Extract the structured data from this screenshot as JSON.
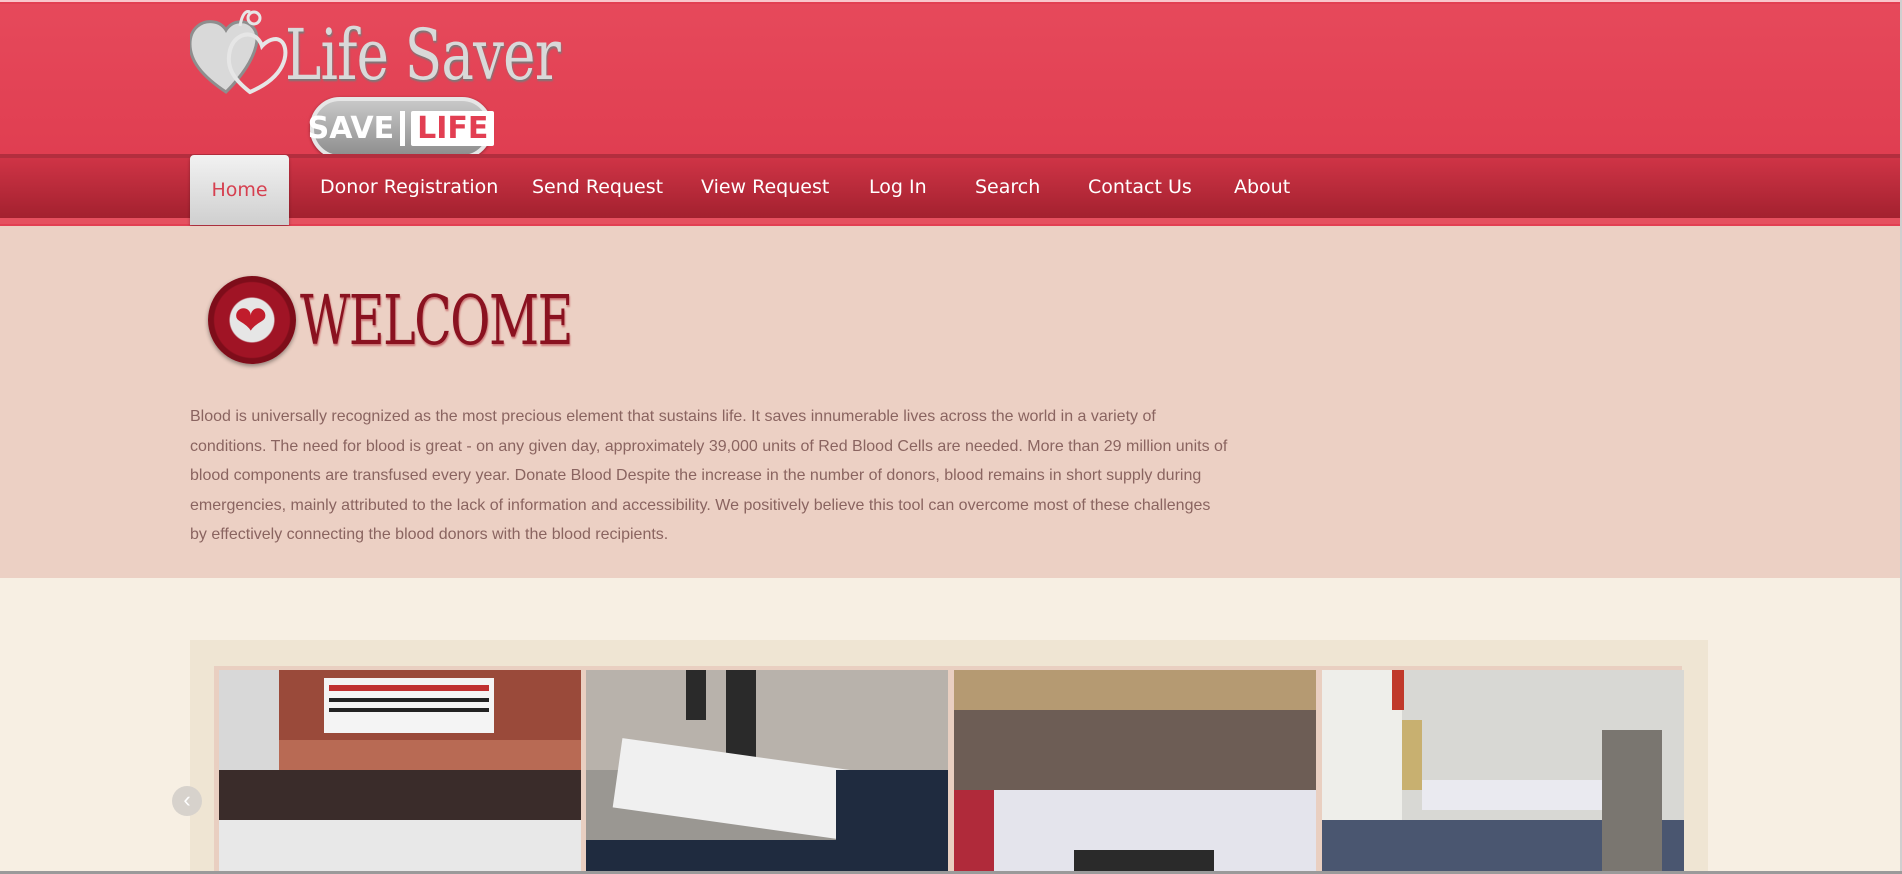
{
  "header": {
    "logo_title": "Life Saver",
    "logo_badge_left": "SAVE",
    "logo_badge_right": "LIFE",
    "colors": {
      "header": "#e23f52",
      "nav": "#b72a3a",
      "welcome_bg": "#ecd0c4",
      "page_bg": "#f7efe3"
    }
  },
  "nav": {
    "items": [
      {
        "label": "Home",
        "active": true
      },
      {
        "label": "Donor Registration"
      },
      {
        "label": "Send Request"
      },
      {
        "label": "View Request"
      },
      {
        "label": "Log In"
      },
      {
        "label": "Search"
      },
      {
        "label": "Contact Us"
      },
      {
        "label": "About"
      }
    ]
  },
  "welcome": {
    "heading": "WELCOME",
    "text": "Blood is universally recognized as the most precious element that sustains life. It saves innumerable lives across the world in a variety of conditions. The need for blood is great - on any given day, approximately 39,000 units of Red Blood Cells are needed. More than 29 million units of blood components are transfused every year. Donate Blood Despite the increase in the number of donors, blood remains in short supply during emergencies, mainly attributed to the lack of information and accessibility. We positively believe this tool can overcome most of these challenges by effectively connecting the blood donors with the blood recipients."
  },
  "gallery": {
    "photos": [
      {
        "subject": "group-photo-banner"
      },
      {
        "subject": "donors-lying"
      },
      {
        "subject": "large-group-photo"
      },
      {
        "subject": "hall-donation-beds"
      }
    ],
    "prev_icon": "chevron-left-icon"
  }
}
